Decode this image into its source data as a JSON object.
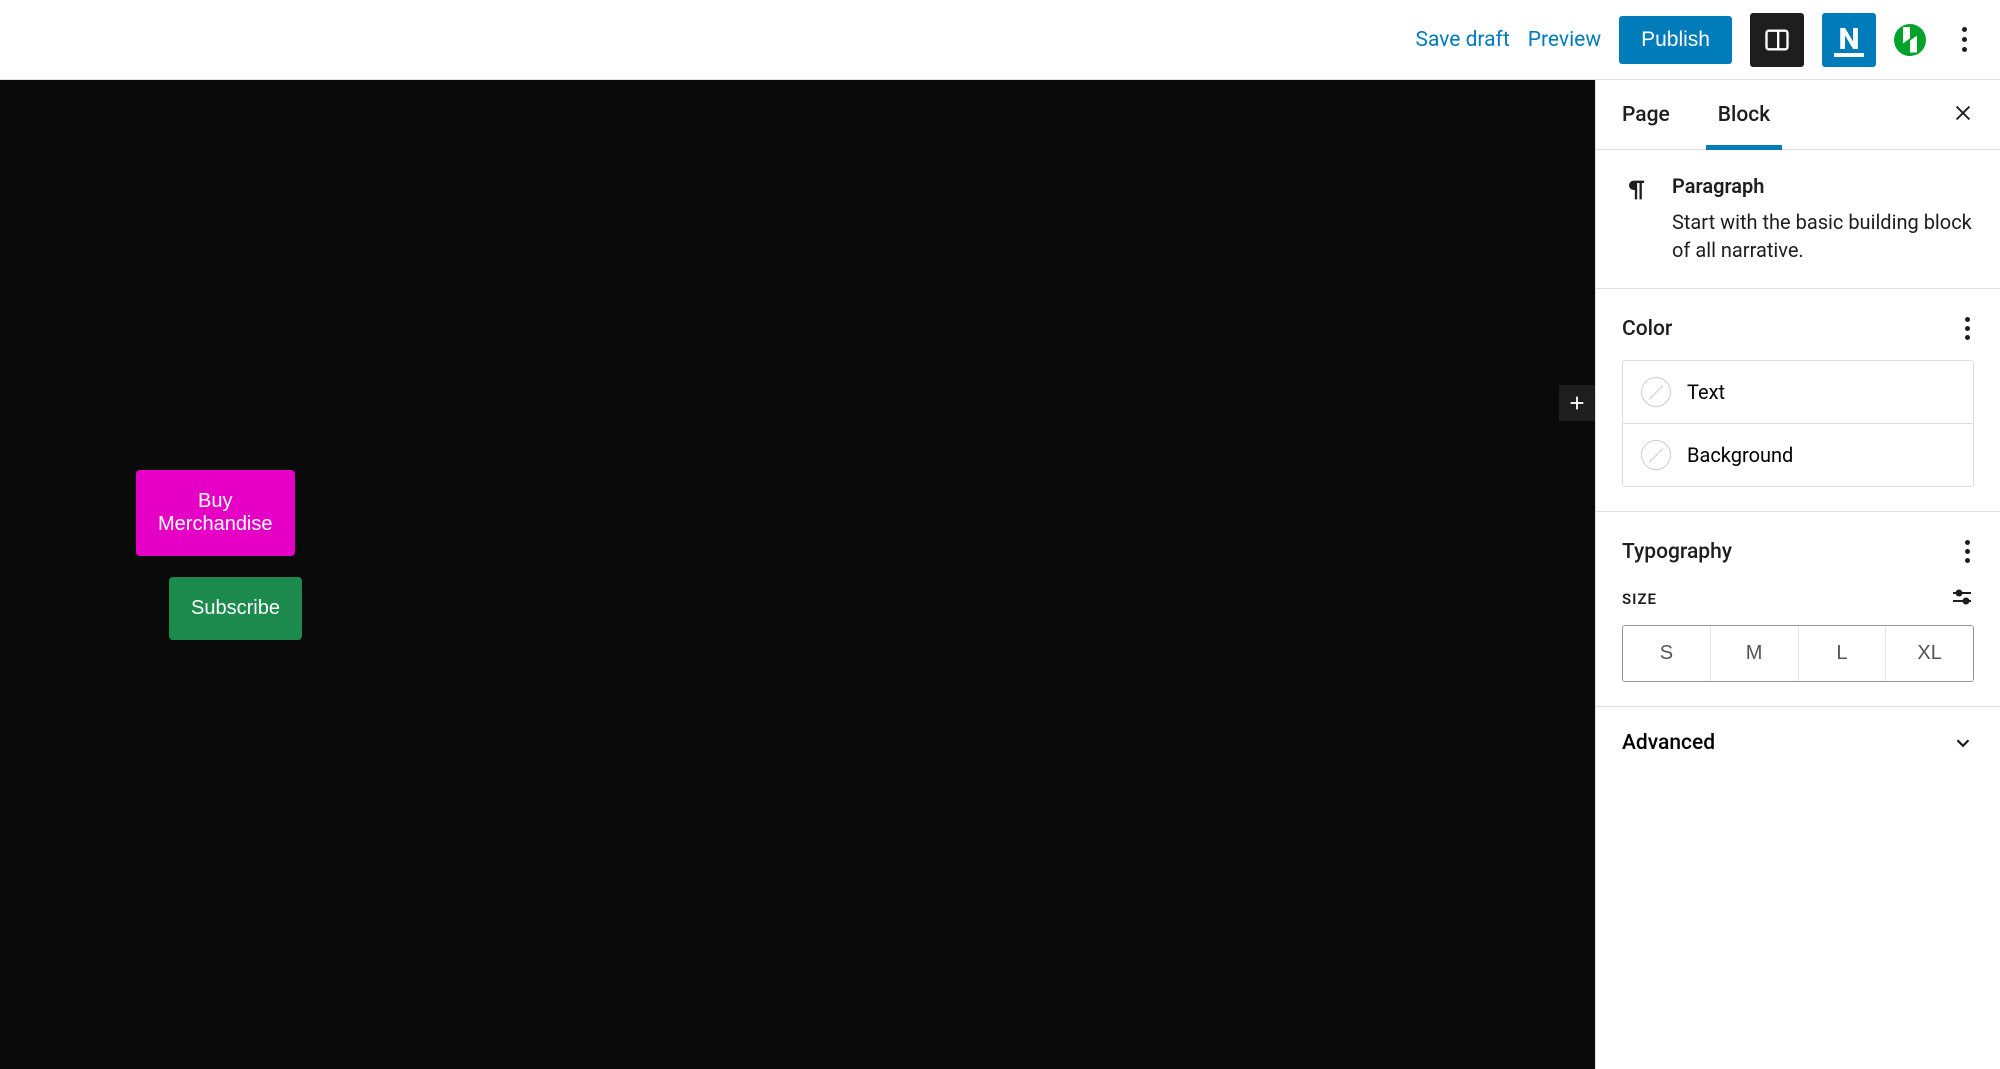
{
  "topbar": {
    "save_draft": "Save draft",
    "preview": "Preview",
    "publish": "Publish"
  },
  "canvas": {
    "button1": "Buy Merchandise",
    "button2": "Subscribe"
  },
  "sidebar": {
    "tabs": {
      "page": "Page",
      "block": "Block"
    },
    "block": {
      "name": "Paragraph",
      "description": "Start with the basic building block of all narrative."
    },
    "color": {
      "title": "Color",
      "text": "Text",
      "background": "Background"
    },
    "typography": {
      "title": "Typography",
      "size_label": "SIZE",
      "sizes": [
        "S",
        "M",
        "L",
        "XL"
      ]
    },
    "advanced": "Advanced"
  }
}
